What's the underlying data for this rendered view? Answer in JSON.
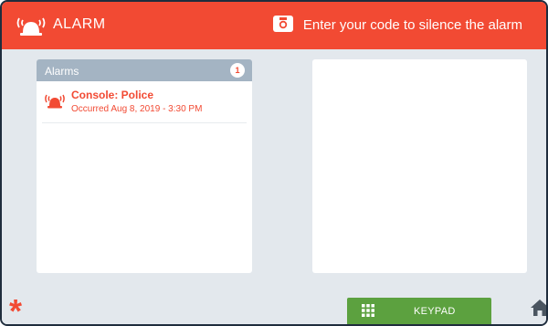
{
  "header": {
    "title": "ALARM",
    "message": "Enter your code to silence the alarm",
    "alarm_icon": "alarm-siren-icon",
    "camera_icon": "camera-icon"
  },
  "alarms_panel": {
    "title": "Alarms",
    "count": "1",
    "items": [
      {
        "title": "Console: Police",
        "time": "Occurred Aug 8, 2019 - 3:30 PM",
        "icon": "alarm-siren-icon"
      }
    ]
  },
  "footer": {
    "emergency_icon": "asterisk-icon",
    "keypad_label": "KEYPAD",
    "keypad_icon": "keypad-grid-icon",
    "home_icon": "home-icon"
  },
  "colors": {
    "accent": "#f24a33",
    "panel_header": "#a4b4c3",
    "keypad_green": "#5ca13f",
    "background": "#e3e8ed"
  }
}
